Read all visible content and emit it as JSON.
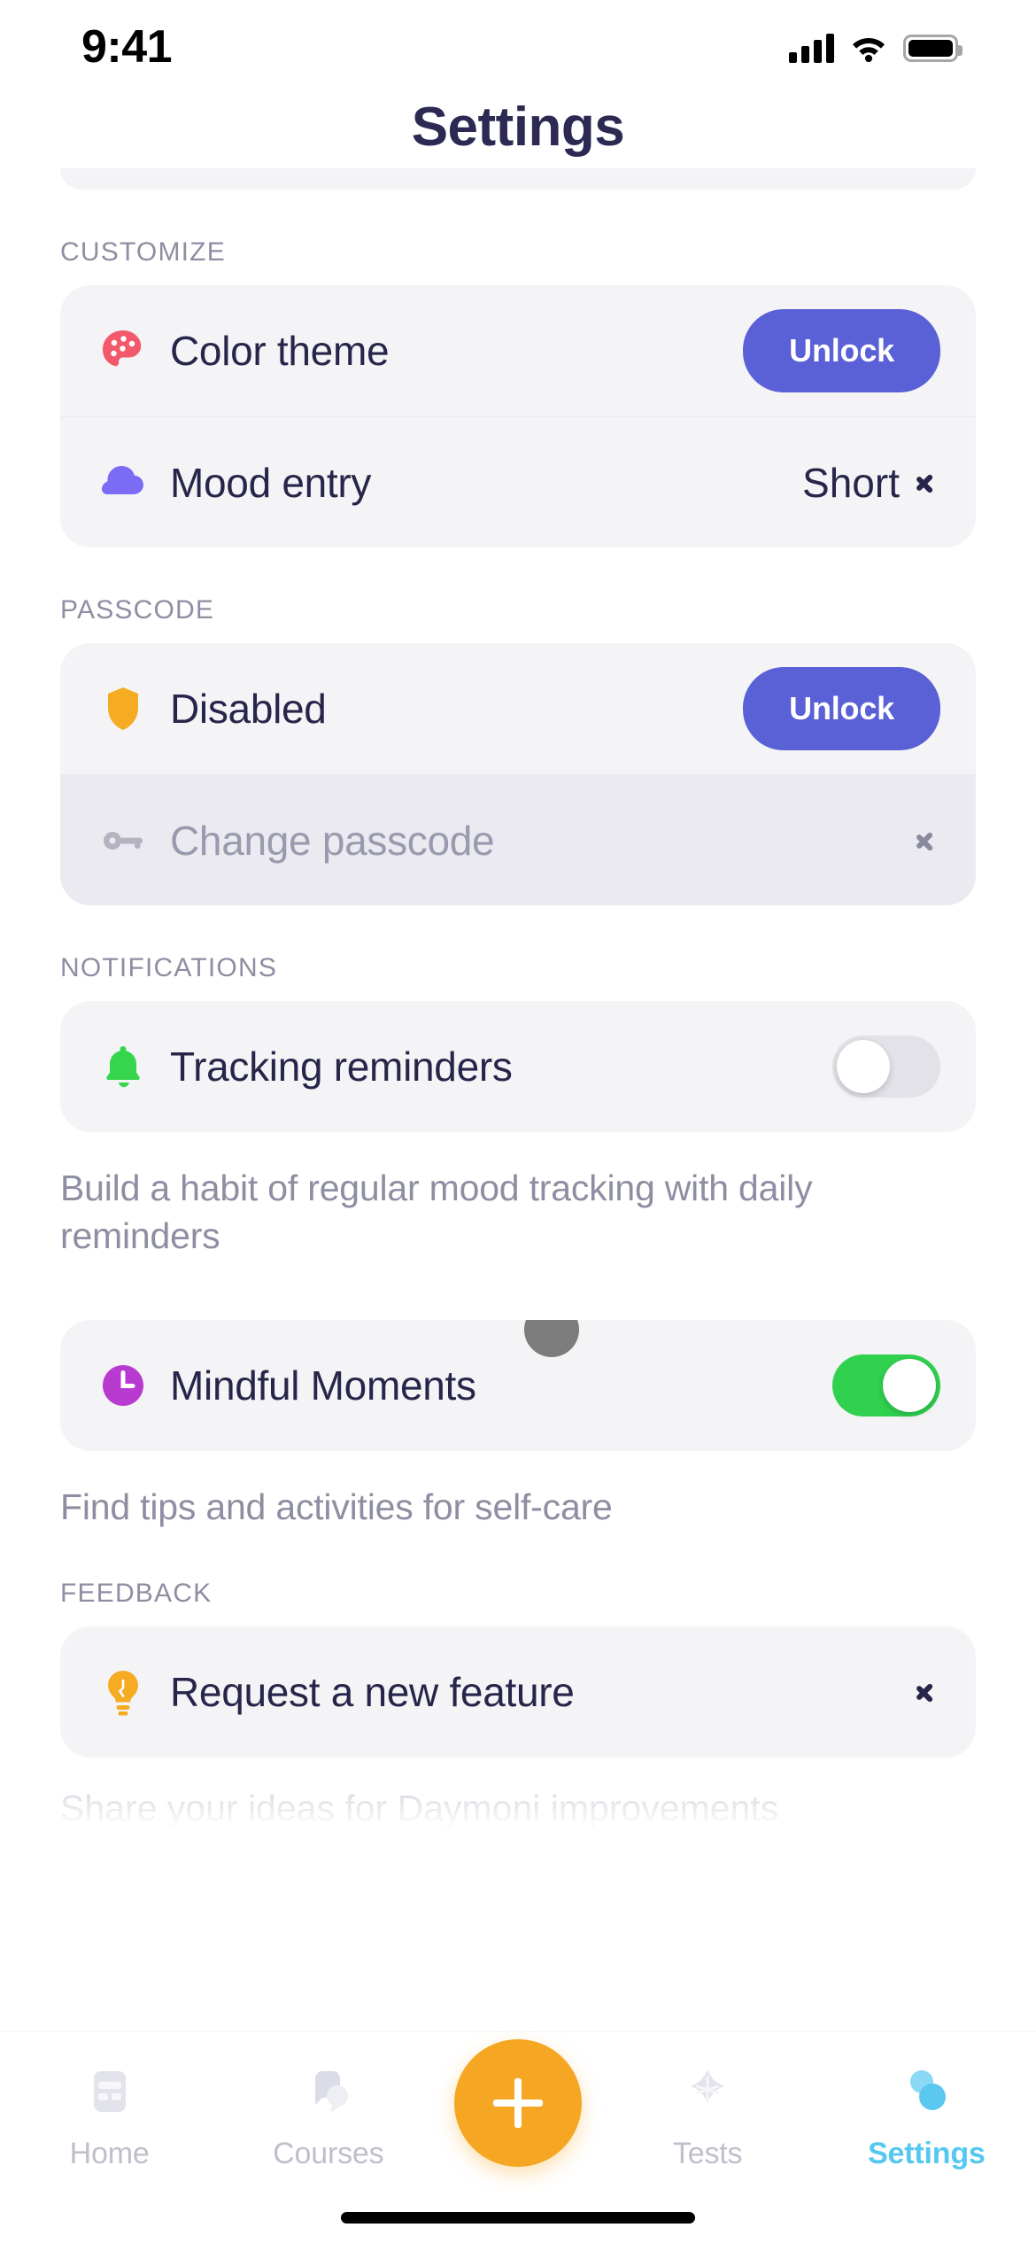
{
  "status_bar": {
    "time": "9:41",
    "signal_icon": "cellular-signal-icon",
    "wifi_icon": "wifi-icon",
    "battery_icon": "battery-full-icon"
  },
  "header": {
    "title": "Settings"
  },
  "colors": {
    "accent_purple": "#5a60d6",
    "toggle_on_green": "#2fd14f",
    "toggle_off_gray": "#e2e2e8",
    "fab_orange": "#f5a623",
    "active_tab_blue": "#55c8f0",
    "title_navy": "#2c2a53",
    "card_bg": "#f4f4f7",
    "muted_row_bg": "#eaeaf0",
    "section_label_gray": "#8e8ea3"
  },
  "sections": [
    {
      "label": "CUSTOMIZE",
      "rows": [
        {
          "icon": "palette-icon",
          "label": "Color theme",
          "control": "button",
          "button_label": "Unlock"
        },
        {
          "icon": "cloud-icon",
          "label": "Mood entry",
          "control": "value-chevron",
          "value": "Short"
        }
      ]
    },
    {
      "label": "PASSCODE",
      "rows": [
        {
          "icon": "shield-icon",
          "label": "Disabled",
          "control": "button",
          "button_label": "Unlock"
        },
        {
          "icon": "key-icon",
          "label": "Change passcode",
          "control": "chevron",
          "disabled": true
        }
      ]
    },
    {
      "label": "NOTIFICATIONS",
      "rows": [
        {
          "icon": "bell-icon",
          "label": "Tracking reminders",
          "control": "toggle",
          "toggle_state": "off"
        }
      ],
      "helper": "Build a habit of regular mood tracking with daily reminders"
    },
    {
      "label": "",
      "rows": [
        {
          "icon": "clock-icon",
          "label": "Mindful Moments",
          "control": "toggle",
          "toggle_state": "on"
        }
      ],
      "helper": "Find tips and activities for self-care"
    },
    {
      "label": "FEEDBACK",
      "rows": [
        {
          "icon": "lightbulb-icon",
          "label": "Request a new feature",
          "control": "chevron"
        }
      ],
      "helper_cut": "Share your ideas for Daymoni improvements"
    }
  ],
  "tabbar": {
    "items": [
      {
        "icon": "home-icon",
        "label": "Home",
        "active": false
      },
      {
        "icon": "courses-icon",
        "label": "Courses",
        "active": false
      },
      {
        "icon": "plus-icon",
        "label": "",
        "active": false
      },
      {
        "icon": "tests-icon",
        "label": "Tests",
        "active": false
      },
      {
        "icon": "settings-icon",
        "label": "Settings",
        "active": true
      }
    ]
  }
}
